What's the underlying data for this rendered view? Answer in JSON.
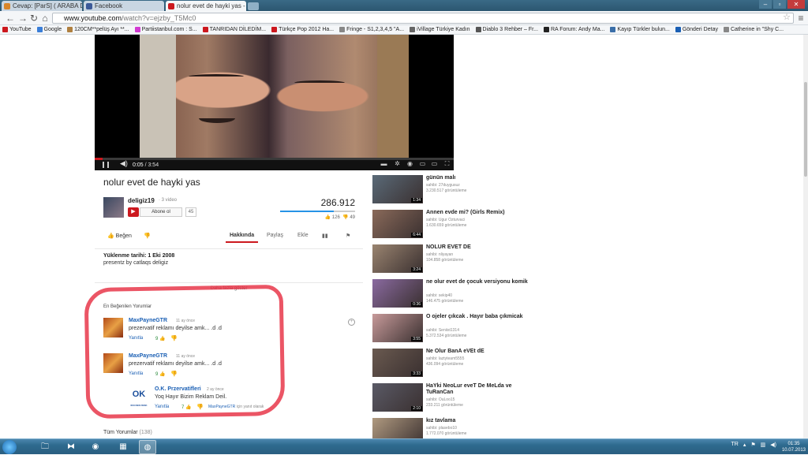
{
  "browser": {
    "tabs": [
      {
        "label": "Cevap: [ParS] ( ARABA DE",
        "favicon": "dh-icon",
        "favcolor": "#d8862a"
      },
      {
        "label": "Facebook",
        "favicon": "facebook-icon",
        "favcolor": "#3b5998"
      },
      {
        "label": "nolur evet de hayki yas -",
        "favicon": "youtube-icon",
        "favcolor": "#cc181e"
      }
    ],
    "url_host": "www.youtube.com",
    "url_path": "/watch?v=ejzby_T5Mc0",
    "bookmarks": [
      {
        "label": "YouTube",
        "color": "#cc181e"
      },
      {
        "label": "Google",
        "color": "#3a7ed8"
      },
      {
        "label": "120CM**pelüş Ayı **...",
        "color": "#b08040"
      },
      {
        "label": "Partiistanbul.com : S...",
        "color": "#d23ad2"
      },
      {
        "label": "TANRIDAN DİLEDİM...",
        "color": "#cc181e"
      },
      {
        "label": "Türkçe Pop 2012 Ha...",
        "color": "#cc181e"
      },
      {
        "label": "Fringe - S1,2,3,4,5 \"A...",
        "color": "#888888"
      },
      {
        "label": "iVillage Türkiye Kadın",
        "color": "#666666"
      },
      {
        "label": "Diablo 3 Rehber – Fr...",
        "color": "#555555"
      },
      {
        "label": "RA Forum: Andy Ma...",
        "color": "#222222"
      },
      {
        "label": "Kayıp Türkler bulun...",
        "color": "#3a6ea8"
      },
      {
        "label": "Gönderi Detay",
        "color": "#1a5fb4"
      },
      {
        "label": "Catherine in \"Shy C...",
        "color": "#888888"
      }
    ]
  },
  "player": {
    "current_time": "0:05",
    "duration": "/ 3:54",
    "progress": 0.021
  },
  "video": {
    "title": "nolur evet de hayki yas",
    "channel": "deligiz19",
    "channel_videos": "· 3 video",
    "subscribe_label": "Abone ol",
    "subscriber_count": "45",
    "views": "286.912",
    "likes": "126",
    "dislikes": "49",
    "like_ratio": 0.72,
    "like_label": "Beğen",
    "tabs": {
      "about": "Hakkında",
      "share": "Paylaş",
      "add": "Ekle"
    },
    "published": "Yüklenme tarihi: 1 Eki 2008",
    "description": "presentz by catlaqs deligiz",
    "show_more": "Daha fazla göster"
  },
  "comments": {
    "top_header": "En Beğenilen Yorumlar",
    "items": [
      {
        "author": "MaxPayneGTR",
        "time": "11 ay önce",
        "text": "prezervatif reklamı deyilse amk... .d .d",
        "reply": "Yanıtla",
        "likes": "9"
      },
      {
        "author": "MaxPayneGTR",
        "time": "11 ay önce",
        "text": "prezervatif reklamı deyilse amk... .d .d",
        "reply": "Yanıtla",
        "likes": "9"
      }
    ],
    "reply_item": {
      "author": "O.K. Przervatifleri",
      "time": "2 ay önce",
      "text": "Yoq Hayır Bizim Reklam Deil.",
      "reply": "Yanıtla",
      "likes": "7",
      "reply_to_user": "MaxPayneGTR",
      "reply_to_suffix": "için yanıt olarak"
    },
    "all_label": "Tüm Yorumlar",
    "all_count": "(138)"
  },
  "recommendations": [
    {
      "title": "günün malı",
      "by": "sahibi: 27duygusuz",
      "views": "3.230.517 görüntüleme",
      "duration": "1:34",
      "thumb": "#5a6a78"
    },
    {
      "title": "Annen evde mi? (Girls Remix)",
      "by": "sahibi: Ugur Ozturvaci",
      "views": "1.630.659 görüntüleme",
      "duration": "6:44",
      "thumb": "#8a6a5a"
    },
    {
      "title": "NOLUR EVET DE",
      "by": "sahibi: nliyayan",
      "views": "104.858 görüntüleme",
      "duration": "3:24",
      "thumb": "#9a8470"
    },
    {
      "title": "ne olur evet de çocuk versiyonu komik",
      "by": "sahibi: sekip40",
      "views": "146.475 görüntüleme",
      "duration": "0:36",
      "thumb": "#8a6aa0"
    },
    {
      "title": "O ojeler çıkcak . Hayır baba çıkmicak",
      "by": "sahibi: Seniist1314",
      "views": "5.372.534 görüntüleme",
      "duration": "3:55",
      "thumb": "#c79a9a"
    },
    {
      "title": "Ne Olur BanA eVEt dE",
      "by": "sahibi: laztyteam5555",
      "views": "436.094 görüntüleme",
      "duration": "3:33",
      "thumb": "#6a5a50"
    },
    {
      "title": "HaYki NeoLur eveT De MeLda ve TuRanCan",
      "by": "sahibi: OuLoo15",
      "views": "233.211 görüntüleme",
      "duration": "2:10",
      "thumb": "#5a5a66"
    },
    {
      "title": "kız tavlama",
      "by": "sahibi: plasebo10",
      "views": "1.772.070 görüntüleme",
      "duration": "",
      "thumb": "#b09a80"
    }
  ],
  "taskbar": {
    "lang": "TR",
    "time": "01:35",
    "date": "10.07.2013"
  }
}
